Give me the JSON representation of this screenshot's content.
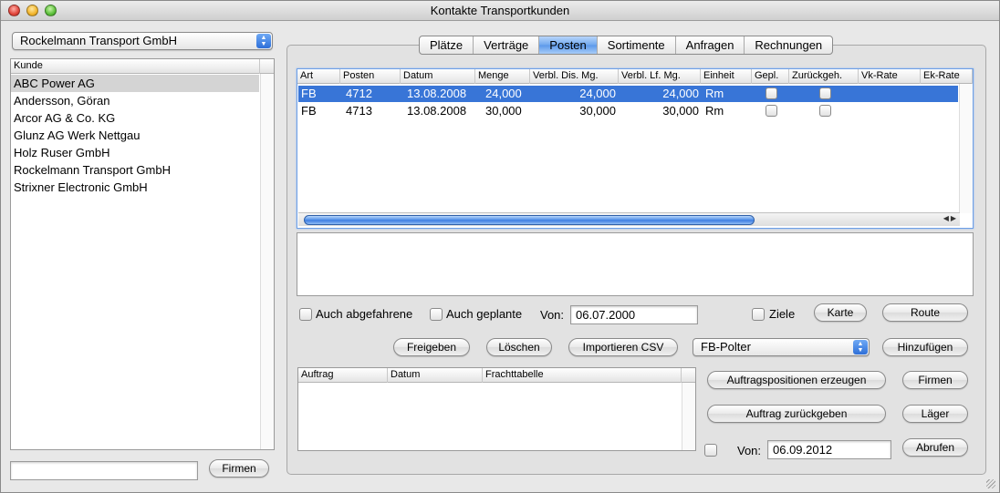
{
  "window": {
    "title": "Kontakte Transportkunden"
  },
  "customer_popup": {
    "value": "Rockelmann Transport GmbH"
  },
  "kunde_list": {
    "header": "Kunde",
    "items": [
      "ABC Power AG",
      "Andersson, Göran",
      "Arcor AG & Co. KG",
      "Glunz AG Werk Nettgau",
      "Holz Ruser GmbH",
      "Rockelmann Transport GmbH",
      "Strixner Electronic GmbH"
    ],
    "selected_index": 0
  },
  "left_search": {
    "value": "",
    "firmen_label": "Firmen"
  },
  "tabs": [
    "Plätze",
    "Verträge",
    "Posten",
    "Sortimente",
    "Anfragen",
    "Rechnungen"
  ],
  "active_tab": "Posten",
  "posten_table": {
    "columns": [
      "Art",
      "Posten",
      "Datum",
      "Menge",
      "Verbl. Dis. Mg.",
      "Verbl. Lf. Mg.",
      "Einheit",
      "Gepl.",
      "Zurückgeh.",
      "Vk-Rate",
      "Ek-Rate"
    ],
    "rows": [
      {
        "art": "FB",
        "posten": "4712",
        "datum": "13.08.2008",
        "menge": "24,000",
        "dis": "24,000",
        "lf": "24,000",
        "einheit": "Rm",
        "selected": true
      },
      {
        "art": "FB",
        "posten": "4713",
        "datum": "13.08.2008",
        "menge": "30,000",
        "dis": "30,000",
        "lf": "30,000",
        "einheit": "Rm",
        "selected": false
      }
    ]
  },
  "filters": {
    "auch_abgefahrene": "Auch abgefahrene",
    "auch_geplante": "Auch geplante",
    "von_label": "Von:",
    "von_value": "06.07.2000",
    "ziele": "Ziele",
    "karte": "Karte",
    "route": "Route"
  },
  "actions": {
    "freigeben": "Freigeben",
    "loeschen": "Löschen",
    "importieren_csv": "Importieren CSV",
    "type_popup": "FB-Polter",
    "hinzufuegen": "Hinzufügen"
  },
  "auftrag_table": {
    "columns": [
      "Auftrag",
      "Datum",
      "Frachttabelle"
    ]
  },
  "auftrag_actions": {
    "erzeugen": "Auftragspositionen erzeugen",
    "firmen": "Firmen",
    "zurueckgeben": "Auftrag zurückgeben",
    "laeger": "Läger",
    "von_label": "Von:",
    "von_value": "06.09.2012",
    "abrufen": "Abrufen"
  },
  "colors": {
    "selection": "#3875d7",
    "accent": "#5b98ea"
  }
}
